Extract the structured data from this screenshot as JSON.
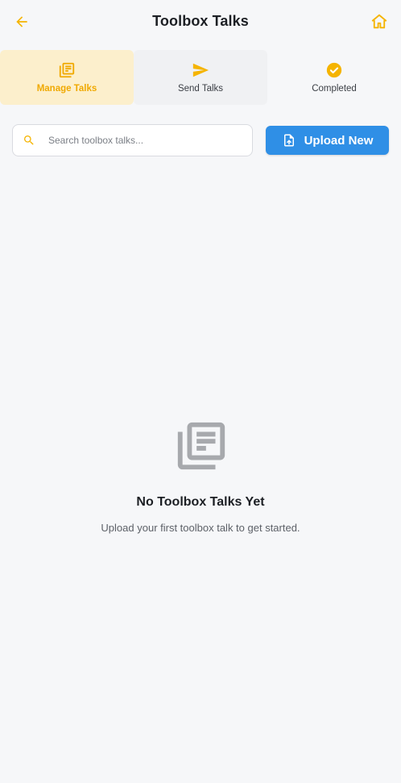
{
  "header": {
    "title": "Toolbox Talks",
    "back_icon": "arrow-back-icon",
    "home_icon": "home-icon",
    "accent_color": "#f5b400"
  },
  "tabs": [
    {
      "label": "Manage Talks",
      "icon": "library-books-icon",
      "active": true
    },
    {
      "label": "Send Talks",
      "icon": "send-icon",
      "active": false
    },
    {
      "label": "Completed",
      "icon": "check-circle-icon",
      "active": false
    }
  ],
  "search": {
    "placeholder": "Search toolbox talks...",
    "value": "",
    "icon": "search-icon"
  },
  "upload": {
    "label": "Upload New",
    "icon": "upload-file-icon",
    "color": "#2f8fe6"
  },
  "empty_state": {
    "icon": "library-books-icon",
    "title": "No Toolbox Talks Yet",
    "subtitle": "Upload your first toolbox talk to get started."
  }
}
